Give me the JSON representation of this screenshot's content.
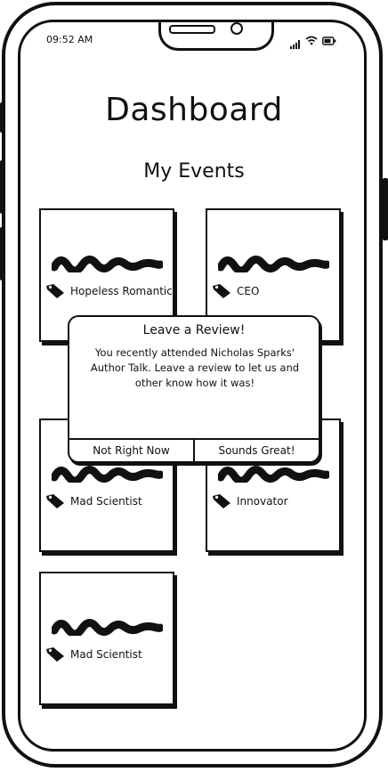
{
  "status_bar": {
    "time": "09:52 AM",
    "icons": [
      "signal-icon",
      "wifi-icon",
      "battery-icon"
    ]
  },
  "header": {
    "title": "Dashboard"
  },
  "main": {
    "section_title": "My Events",
    "events": [
      {
        "label": "Hopeless Romantic"
      },
      {
        "label": "CEO"
      },
      {
        "label": "Mad Scientist"
      },
      {
        "label": "Innovator"
      },
      {
        "label": "Mad Scientist"
      }
    ]
  },
  "dialog": {
    "title": "Leave a Review!",
    "body": "You recently attended Nicholas Sparks' Author Talk. Leave a review to let us and other know how it was!",
    "secondary_label": "Not Right Now",
    "primary_label": "Sounds Great!"
  }
}
